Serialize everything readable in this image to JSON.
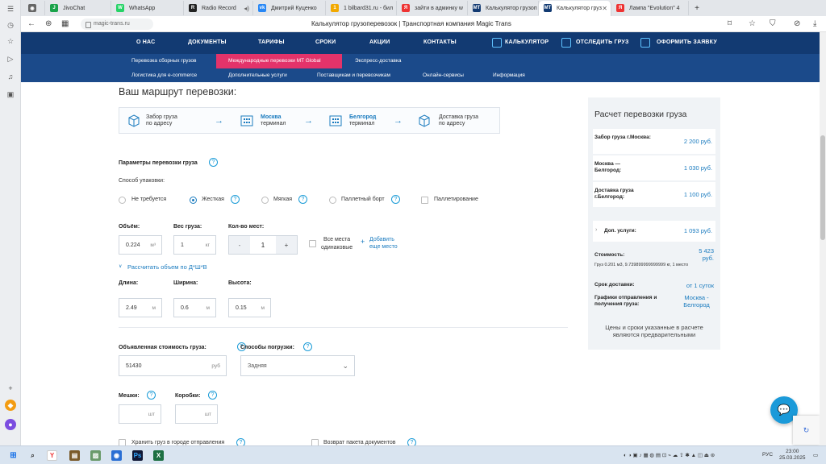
{
  "browser": {
    "tabs": [
      {
        "label": "",
        "color": "#555",
        "icon": "globe-icon"
      },
      {
        "label": "JivoChat",
        "color": "#1aa34a",
        "icon": "jivo-icon"
      },
      {
        "label": "WhatsApp",
        "color": "#25d366",
        "icon": "whatsapp-icon"
      },
      {
        "label": "Radio Record",
        "color": "#222",
        "icon": "radio-icon"
      },
      {
        "label": "Дмитрий Куценко",
        "color": "#2787f5",
        "icon": "vk-icon"
      },
      {
        "label": "1 bilbard31.ru - бил",
        "color": "#f2a900",
        "icon": "site-icon"
      },
      {
        "label": "зайти в админку w",
        "color": "#e33",
        "icon": "search-icon"
      },
      {
        "label": "Калькулятор грузоп",
        "color": "#123a72",
        "icon": "mt-icon"
      },
      {
        "label": "Калькулятор груз",
        "color": "#123a72",
        "icon": "mt-icon"
      },
      {
        "label": "Лампа \"Evolution\" 4",
        "color": "#e33",
        "icon": "yandex-icon"
      }
    ],
    "url": "magic-trans.ru",
    "page_title": "Калькулятор грузоперевозок | Транспортная компания Magic Trans"
  },
  "nav": {
    "main": [
      "О НАС",
      "ДОКУМЕНТЫ",
      "ТАРИФЫ",
      "СРОКИ",
      "АКЦИИ",
      "КОНТАКТЫ"
    ],
    "calculator": "КАЛЬКУЛЯТОР",
    "track": "ОТСЛЕДИТЬ ГРУЗ",
    "order": "ОФОРМИТЬ ЗАЯВКУ",
    "sub_row1": [
      "Перевозка сборных грузов",
      "Международные перевозки MT Global",
      "Экспресс-доставка"
    ],
    "sub_row2": [
      "Логистика для e-commerce",
      "Дополнительные услуги",
      "Поставщикам и перевозчикам",
      "Онлайн-сервисы",
      "Информация"
    ]
  },
  "route": {
    "heading": "Ваш маршрут перевозки:",
    "steps": [
      {
        "l1": "Забор груза",
        "l2": "по адресу"
      },
      {
        "l1": "Москва",
        "l2": "терминал"
      },
      {
        "l1": "Белгород",
        "l2": "терминал"
      },
      {
        "l1": "Доставка груза",
        "l2": "по адресу"
      }
    ]
  },
  "params": {
    "title": "Параметры перевозки груза",
    "packing_label": "Способ упаковки:",
    "packing_options": [
      "Не требуется",
      "Жесткая",
      "Мягкая",
      "Паллетный борт",
      "Паллетирование"
    ],
    "packing_selected": "Жесткая",
    "volume_label": "Объём:",
    "volume_value": "0.224",
    "volume_unit": "м³",
    "weight_label": "Вес груза:",
    "weight_value": "1",
    "weight_unit": "кг",
    "places_label": "Кол-во мест:",
    "places_value": "1",
    "minus": "-",
    "plus": "+",
    "all_same_1": "Все места",
    "all_same_2": "одинаковые",
    "add_place_1": "Добавить",
    "add_place_2": "еще место",
    "calc_volume": "Рассчитать объем по Д*Ш*В",
    "length_label": "Длина:",
    "length_value": "2.49",
    "width_label": "Ширина:",
    "width_value": "0.6",
    "height_label": "Высота:",
    "height_value": "0.15",
    "m": "м",
    "declared_label": "Объявленная стоимость груза:",
    "declared_value": "51430",
    "rub": "руб",
    "loading_label": "Способы погрузки:",
    "loading_value": "Задняя",
    "bags_label": "Мешки:",
    "boxes_label": "Коробки:",
    "pcs": "шт",
    "store_label": "Хранить груз в городе отправления",
    "return_label": "Возврат пакета документов"
  },
  "summary": {
    "title": "Расчет перевозки груза",
    "rows": [
      {
        "k": "Забор груза г.Москва:",
        "v": "2 200 руб."
      },
      {
        "k": "Москва — Белгород:",
        "v": "1 030 руб."
      },
      {
        "k": "Доставка груза г.Белгород:",
        "v": "1 100 руб."
      },
      {
        "k": "Доп. услуги:",
        "v": "1 093 руб."
      }
    ],
    "cost_label": "Стоимость:",
    "cost_value": "5 423 руб.",
    "cost_note": "Груз 0.201 м3, 9.739899999999999 кг, 1 место",
    "term_label": "Срок доставки:",
    "term_value": "от 1 суток",
    "schedule_label": "Графики отправления и получения груза:",
    "schedule_value": "Москва - Белгород",
    "disclaimer": "Цены и сроки указанные в расчете являются предварительными"
  },
  "taskbar": {
    "lang": "РУС",
    "time": "23:00",
    "date": "25.03.2025"
  }
}
